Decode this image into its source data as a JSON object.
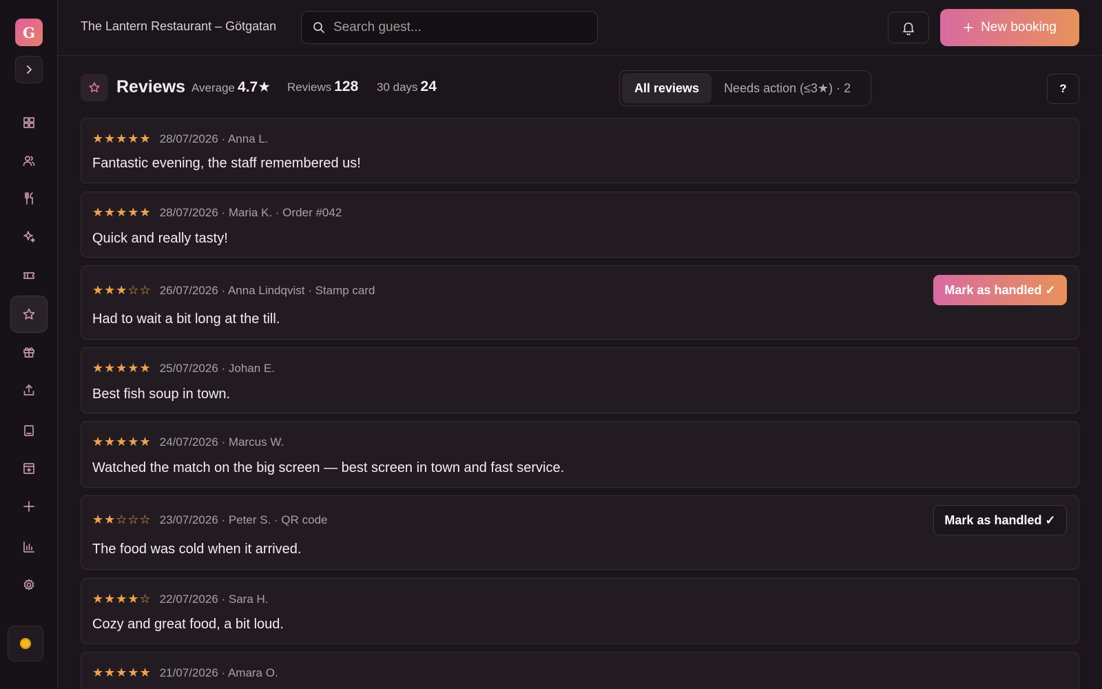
{
  "app": {
    "logo_letter": "G"
  },
  "header": {
    "venue": "The Lantern Restaurant – Götgatan",
    "search_placeholder": "Search guest...",
    "new_booking_label": "New booking"
  },
  "sidebar": {
    "items": [
      {
        "name": "dashboard",
        "icon": "grid-icon"
      },
      {
        "name": "guests",
        "icon": "users-icon"
      },
      {
        "name": "menu",
        "icon": "utensils-icon"
      },
      {
        "name": "ai",
        "icon": "sparkles-icon"
      },
      {
        "name": "tickets",
        "icon": "ticket-icon"
      },
      {
        "name": "reviews",
        "icon": "star-icon",
        "active": true
      },
      {
        "name": "gifts",
        "icon": "gift-icon"
      },
      {
        "name": "export",
        "icon": "upload-icon"
      },
      {
        "name": "bookings",
        "icon": "book-icon"
      },
      {
        "name": "archive",
        "icon": "archive-icon"
      },
      {
        "name": "add",
        "icon": "plus-icon"
      },
      {
        "name": "stats",
        "icon": "bar-chart-icon"
      },
      {
        "name": "settings",
        "icon": "gear-icon"
      }
    ]
  },
  "toolbar": {
    "title": "Reviews",
    "average_label": "Average",
    "average_value": "4.7★",
    "reviews_label": "Reviews",
    "reviews_value": "128",
    "days_label": "30 days",
    "days_value": "24",
    "tab_all": "All reviews",
    "tab_needs_action": "Needs action (≤3★) · 2",
    "help_label": "?"
  },
  "colors": {
    "accent_start": "#d86aa0",
    "accent_end": "#e8925a",
    "star": "#f0a24b"
  },
  "reviews": [
    {
      "stars": "★★★★★",
      "meta": "28/07/2026 · Anna L.",
      "text": "Fantastic evening, the staff remembered us!"
    },
    {
      "stars": "★★★★★",
      "meta": "28/07/2026 · Maria K. · Order #042",
      "text": "Quick and really tasty!"
    },
    {
      "stars": "★★★☆☆",
      "meta": "26/07/2026 · Anna Lindqvist · Stamp card",
      "text": "Had to wait a bit long at the till.",
      "action": "Mark as handled ✓"
    },
    {
      "stars": "★★★★★",
      "meta": "25/07/2026 · Johan E.",
      "text": "Best fish soup in town."
    },
    {
      "stars": "★★★★★",
      "meta": "24/07/2026 · Marcus W.",
      "text": "Watched the match on the big screen — best screen in town and fast service."
    },
    {
      "stars": "★★☆☆☆",
      "meta": "23/07/2026 · Peter S. · QR code",
      "text": "The food was cold when it arrived.",
      "action": "Mark as handled ✓"
    },
    {
      "stars": "★★★★☆",
      "meta": "22/07/2026 · Sara H.",
      "text": "Cozy and great food, a bit loud."
    },
    {
      "stars": "★★★★★",
      "meta": "21/07/2026 · Amara O."
    }
  ]
}
